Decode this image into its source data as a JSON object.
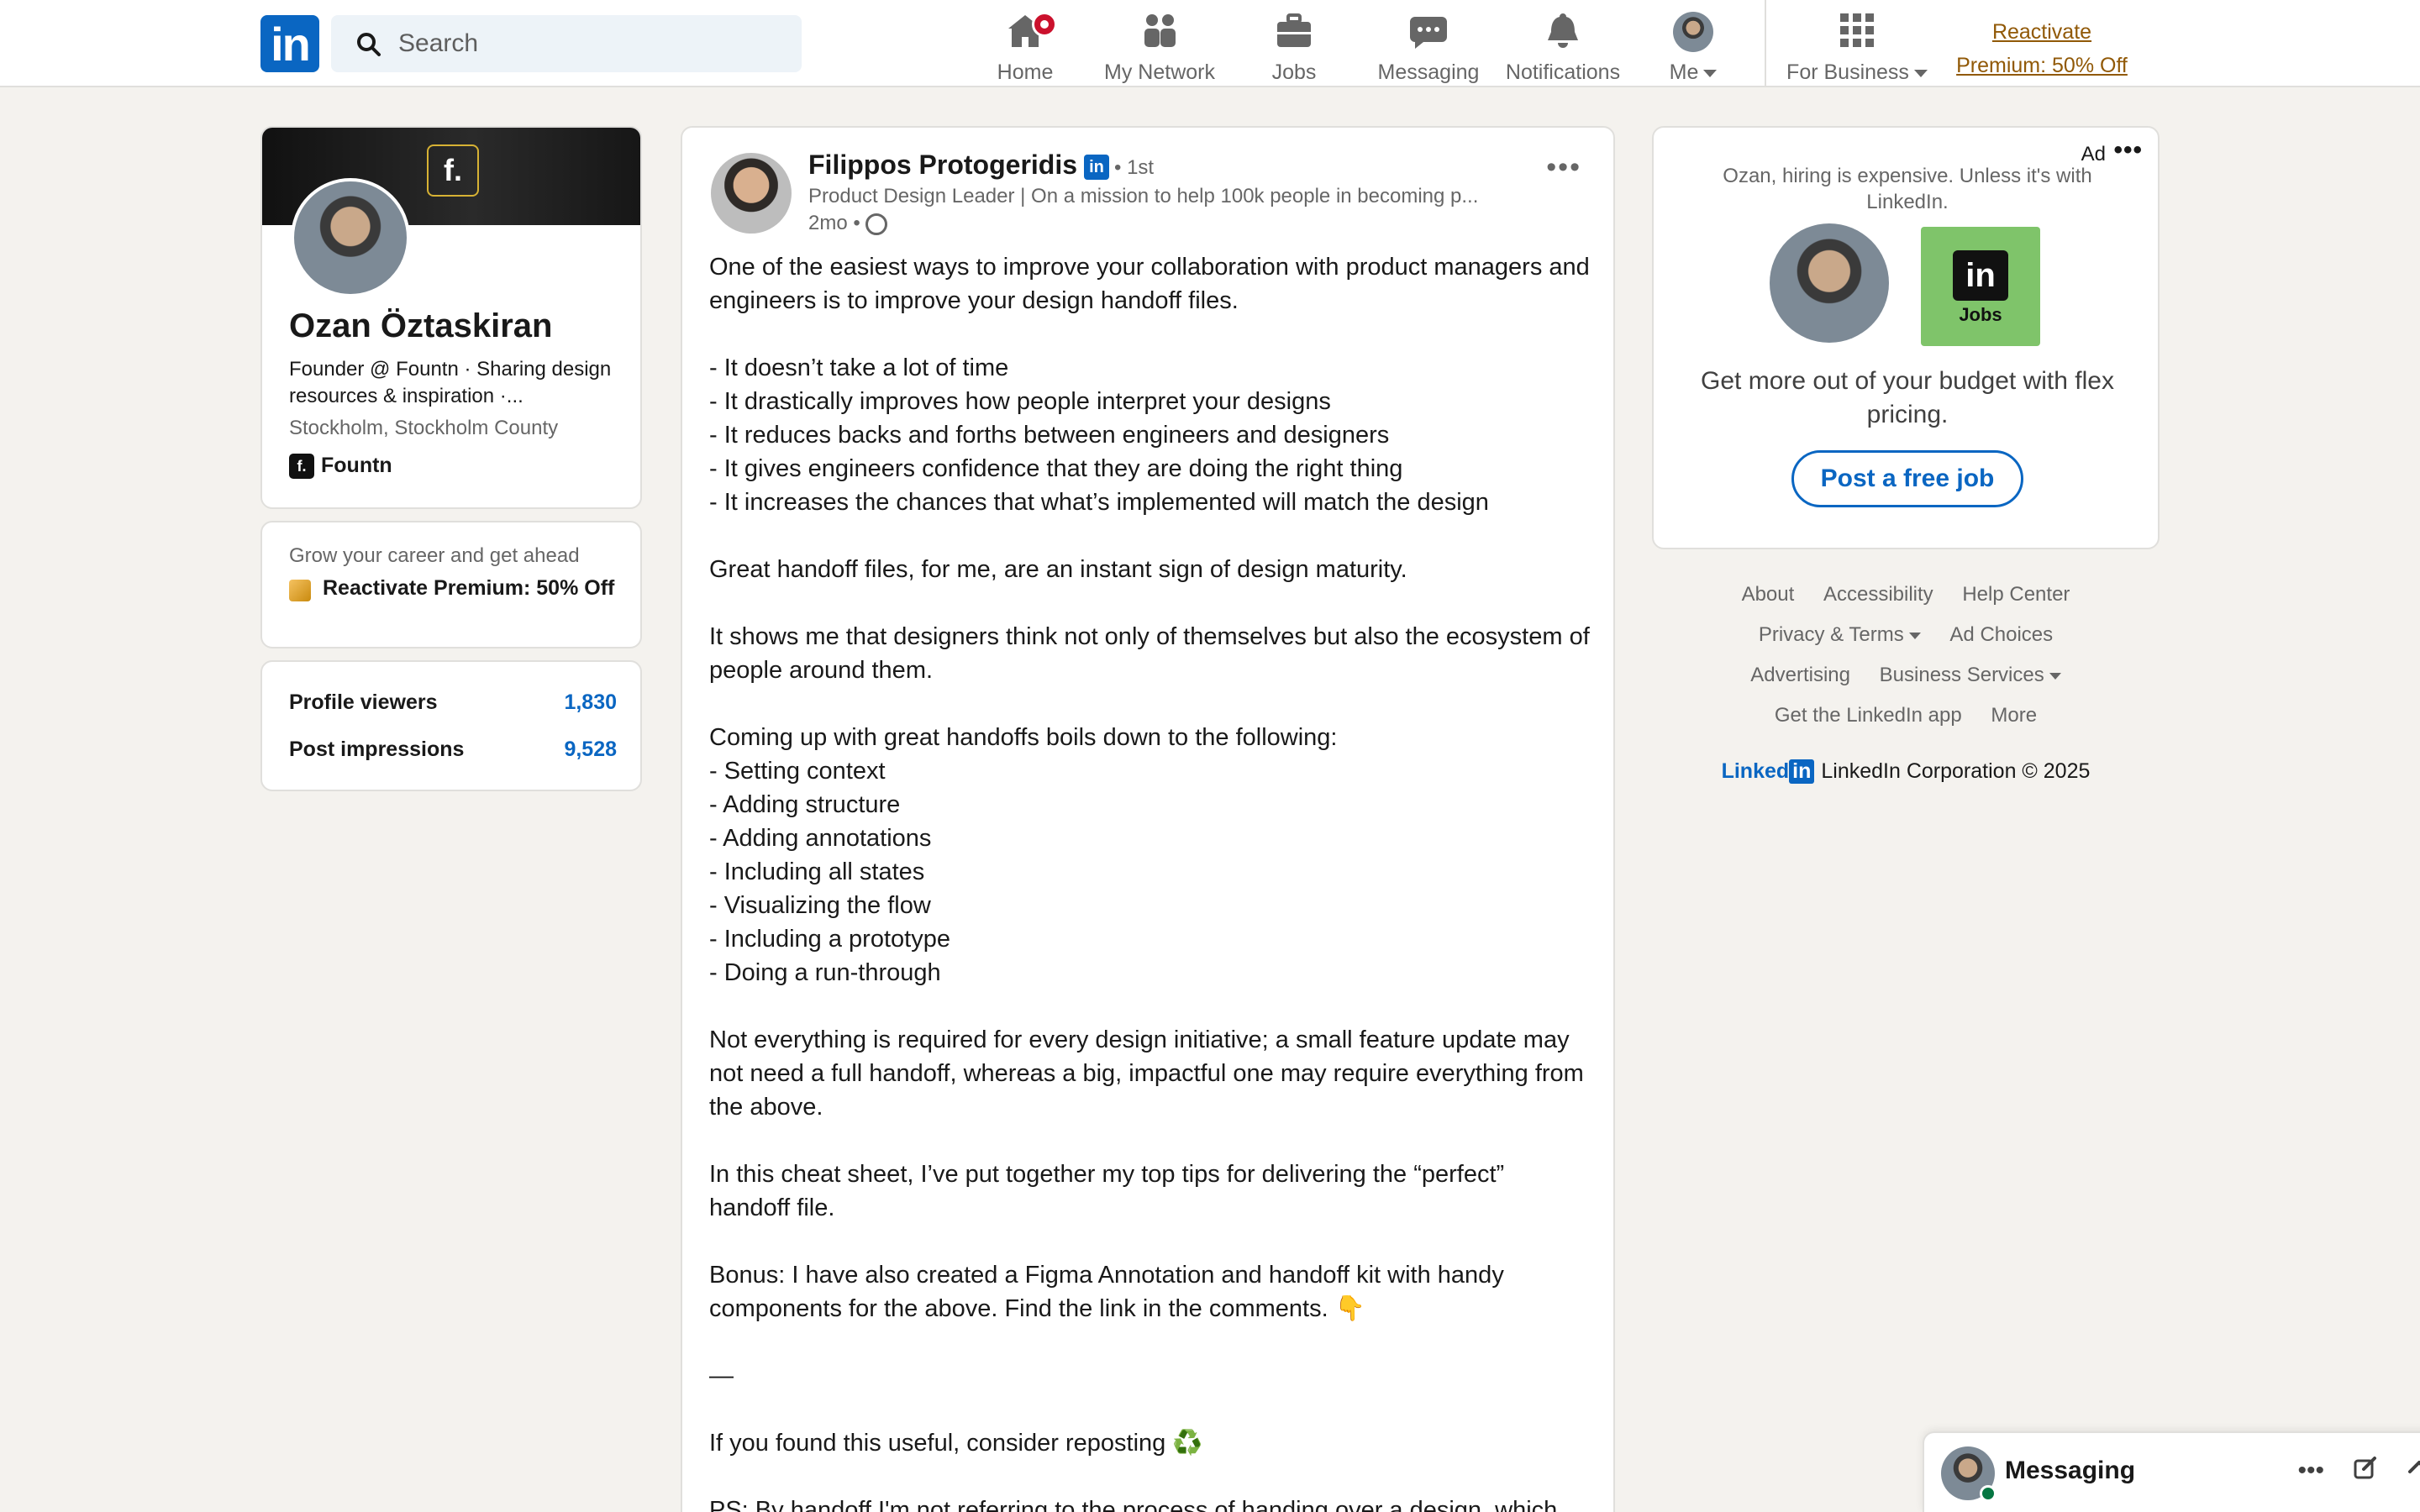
{
  "nav": {
    "logo": "in",
    "search_placeholder": "Search",
    "items": [
      {
        "label": "Home",
        "icon": "home-icon"
      },
      {
        "label": "My Network",
        "icon": "people-icon"
      },
      {
        "label": "Jobs",
        "icon": "briefcase-icon"
      },
      {
        "label": "Messaging",
        "icon": "chat-icon"
      },
      {
        "label": "Notifications",
        "icon": "bell-icon"
      },
      {
        "label": "Me",
        "icon": "avatar"
      },
      {
        "label": "For Business",
        "icon": "grid-icon"
      }
    ],
    "reactivate_line1": "Reactivate",
    "reactivate_line2": "Premium: 50% Off"
  },
  "profile": {
    "name": "Ozan Öztaskiran",
    "headline": "Founder @ Fountn · Sharing design resources & inspiration ·...",
    "location": "Stockholm, Stockholm County",
    "company": "Fountn",
    "cover_logo": "f."
  },
  "premium": {
    "prompt": "Grow your career and get ahead",
    "offer": "Reactivate Premium: 50% Off"
  },
  "stats": [
    {
      "label": "Profile viewers",
      "value": "1,830"
    },
    {
      "label": "Post impressions",
      "value": "9,528"
    }
  ],
  "post": {
    "author": "Filippos Protogeridis",
    "degree": "• 1st",
    "subtitle": "Product Design Leader | On a mission to help 100k people in becoming p...",
    "time": "2mo •",
    "paragraphs": [
      "One of the easiest ways to improve your collaboration with product managers and engineers is to improve your design handoff files.",
      "- It doesn’t take a lot of time\n- It drastically improves how people interpret your designs\n- It reduces backs and forths between engineers and designers\n- It gives engineers confidence that they are doing the right thing\n- It increases the chances that what’s implemented will match the design",
      "Great handoff files, for me, are an instant sign of design maturity.",
      "It shows me that designers think not only of themselves but also the ecosystem of people around them.",
      "Coming up with great handoffs boils down to the following:\n- Setting context\n- Adding structure\n- Adding annotations\n- Including all states\n- Visualizing the flow\n- Including a prototype\n- Doing a run-through",
      "Not everything is required for every design initiative; a small feature update may not need a full handoff, whereas a big, impactful one may require everything from the above.",
      "In this cheat sheet, I’ve put together my top tips for delivering the “perfect” handoff file.",
      "Bonus: I have also created a Figma Annotation and handoff kit with handy components for the above. Find the link in the comments. 👇",
      "—",
      "If you found this useful, consider reposting ♻️",
      "PS: By handoff I'm not referring to the process of handing over a design, which"
    ]
  },
  "ad": {
    "label": "Ad",
    "tagline": "Ozan, hiring is expensive. Unless it's with LinkedIn.",
    "jobs_logo": "in",
    "jobs_label": "Jobs",
    "copy": "Get more out of your budget with flex pricing.",
    "cta": "Post a free job"
  },
  "footer": {
    "row1": [
      "About",
      "Accessibility",
      "Help Center"
    ],
    "row2": [
      "Privacy & Terms",
      "Ad Choices"
    ],
    "row3": [
      "Advertising",
      "Business Services"
    ],
    "row4": [
      "Get the LinkedIn app",
      "More"
    ],
    "brand_word": "Linked",
    "brand_box": "in",
    "copyright": "LinkedIn Corporation © 2025"
  },
  "messaging": {
    "title": "Messaging"
  },
  "colors": {
    "brand": "#0a66c2",
    "premium_gold": "#915907",
    "notification_red": "#cb112d",
    "online_green": "#057642"
  }
}
